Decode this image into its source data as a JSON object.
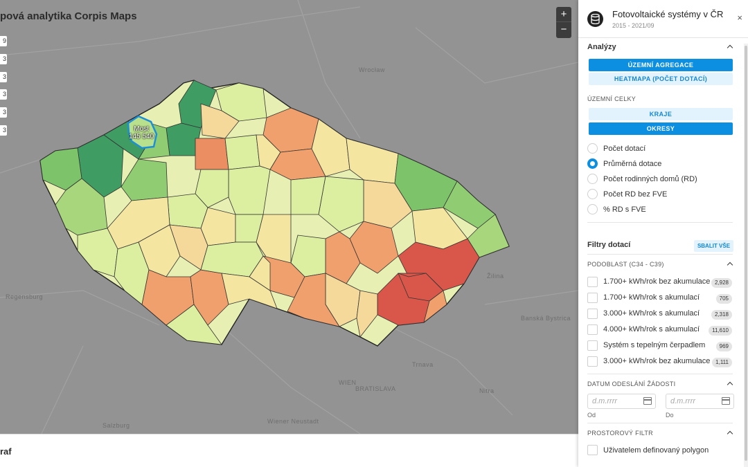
{
  "map": {
    "title": "pová analytika Corpis Maps",
    "legend_digits": [
      "9",
      "3",
      "3",
      "3",
      "3",
      "3"
    ],
    "zoom_in": "+",
    "zoom_out": "−",
    "highlight": {
      "name": "Most",
      "value": "145 540"
    },
    "place_labels": [
      "Wrocław",
      "Regensburg",
      "Banská Bystrica",
      "Žilina",
      "Trnava",
      "WIEN",
      "BRATISLAVA",
      "Salzburg",
      "Nitra",
      "Wiener Neustadt"
    ],
    "colors": {
      "dark_green": "#3f9c62",
      "green": "#7cc36a",
      "light_green": "#b9e08c",
      "yellow_green": "#dcefa0",
      "light_yellow": "#f4e6a0",
      "orange": "#f0a06c",
      "red_orange": "#e47a58",
      "red": "#d9574a",
      "highlight": "#1d8fd8"
    }
  },
  "bottom": {
    "label": "raf"
  },
  "panel": {
    "title": "Fotovoltaické systémy v ČR",
    "subtitle": "2015 - 2021/09",
    "close": "×",
    "analyzy": {
      "heading": "Analýzy",
      "buttons": [
        "ÚZEMNÍ AGREGACE",
        "HEATMAPA (POČET DOTACÍ)"
      ]
    },
    "uzemni_celky": {
      "heading": "ÚZEMNÍ CELKY",
      "buttons": [
        "KRAJE",
        "OKRESY"
      ]
    },
    "metrics": [
      {
        "label": "Počet dotací",
        "selected": false
      },
      {
        "label": "Průměrná dotace",
        "selected": true
      },
      {
        "label": "Počet rodinných domů (RD)",
        "selected": false
      },
      {
        "label": "Počet RD bez FVE",
        "selected": false
      },
      {
        "label": "% RD s FVE",
        "selected": false
      }
    ],
    "filtry": {
      "heading": "Filtry dotací",
      "collapse_all": "SBALIT VŠE",
      "podoblast_heading": "PODOBLAST (C34 - C39)",
      "items": [
        {
          "label": "1.700+ kWh/rok bez akumulace",
          "count": "2,928"
        },
        {
          "label": "1.700+ kWh/rok s akumulací",
          "count": "705"
        },
        {
          "label": "3.000+ kWh/rok s akumulací",
          "count": "2,318"
        },
        {
          "label": "4.000+ kWh/rok s akumulací",
          "count": "11,610"
        },
        {
          "label": "Systém s tepelným čerpadlem",
          "count": "969"
        },
        {
          "label": "3.000+ kWh/rok bez akumulace",
          "count": "1,111"
        }
      ],
      "datum_heading": "DATUM ODESLÁNÍ ŽÁDOSTI",
      "date_placeholder": "d.m.rrrr",
      "od": "Od",
      "do": "Do",
      "prostor_heading": "PROSTOROVÝ FILTR",
      "polygon_label": "Uživatelem definovaný polygon"
    }
  }
}
